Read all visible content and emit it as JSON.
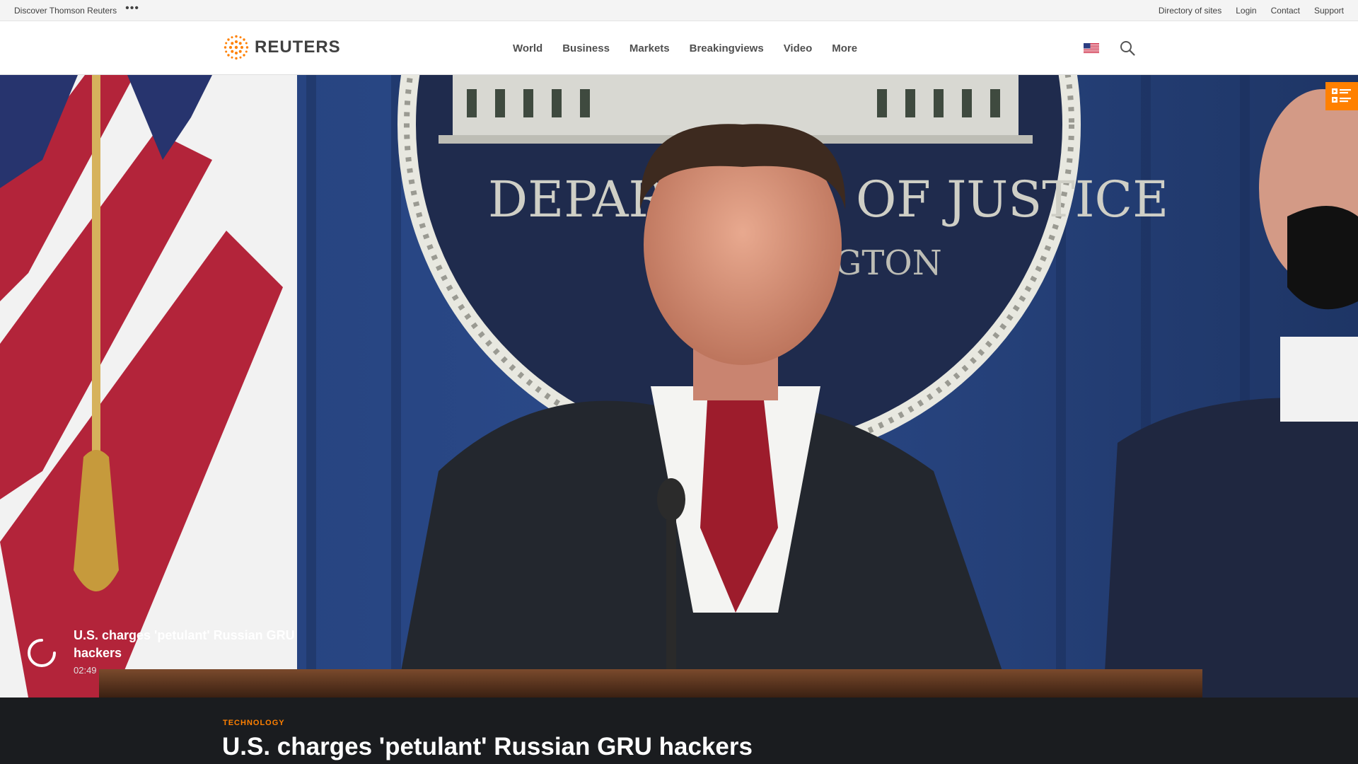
{
  "utility_bar": {
    "discover_label": "Discover Thomson Reuters",
    "more_icon": "ellipsis-icon",
    "links": [
      "Directory of sites",
      "Login",
      "Contact",
      "Support"
    ]
  },
  "header": {
    "logo_text": "REUTERS",
    "logo_icon": "reuters-dot-logo",
    "nav": [
      "World",
      "Business",
      "Markets",
      "Breakingviews",
      "Video",
      "More"
    ],
    "edition_icon": "us-flag-icon",
    "search_icon": "search-icon"
  },
  "video": {
    "title": "U.S. charges 'petulant' Russian GRU hackers",
    "duration": "02:49",
    "status_icon": "loading-spinner-icon",
    "playlist_icon": "playlist-icon",
    "backdrop_text_line1": "DEPAR",
    "backdrop_text_line1b": "OF JUSTICE",
    "backdrop_text_line2": "GTON"
  },
  "article": {
    "category": "TECHNOLOGY",
    "headline": "U.S. charges 'petulant' Russian GRU hackers"
  },
  "colors": {
    "accent": "#ff8000",
    "header_bg": "#ffffff",
    "utility_bg": "#f4f4f4",
    "article_bg": "#1a1c1f"
  }
}
